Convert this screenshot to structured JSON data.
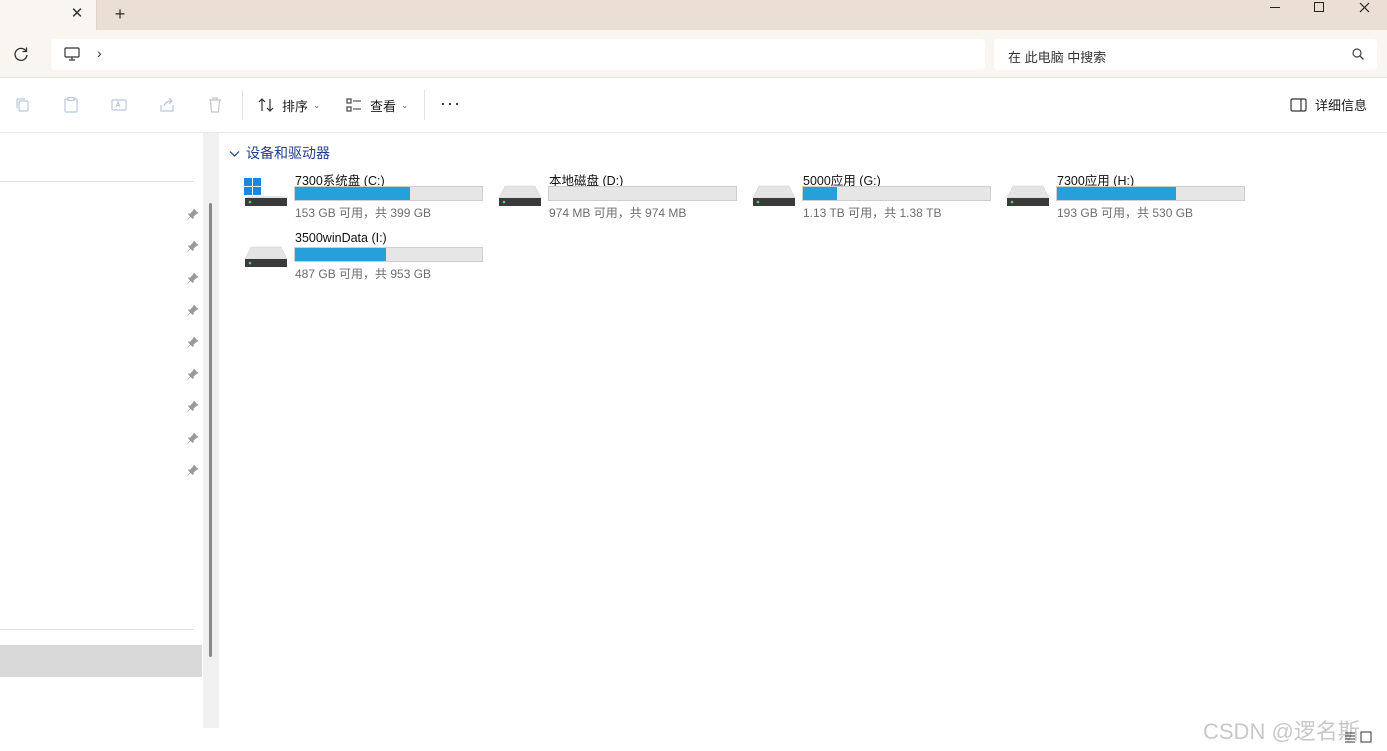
{
  "window": {
    "tab_close_glyph": "✕",
    "new_tab_glyph": "+",
    "controls": [
      "minimize-icon",
      "maximize-icon",
      "close-icon"
    ]
  },
  "address": {
    "breadcrumb_icon": "this-pc-icon",
    "breadcrumb_chevron": "›",
    "search_placeholder": "在 此电脑 中搜索"
  },
  "toolbar": {
    "sort_label": "排序",
    "view_label": "查看",
    "more_label": "···",
    "details_label": "详细信息"
  },
  "main": {
    "group_label": "设备和驱动器",
    "drives": [
      {
        "name": "7300系统盘 (C:)",
        "size_text": "153 GB 可用，共 399 GB",
        "used_fraction": 0.617,
        "icon": "windows-drive-icon"
      },
      {
        "name": "本地磁盘 (D:)",
        "size_text": "974 MB 可用，共 974 MB",
        "used_fraction": 0.0,
        "icon": "drive-icon"
      },
      {
        "name": "5000应用 (G:)",
        "size_text": "1.13 TB 可用，共 1.38 TB",
        "used_fraction": 0.181,
        "icon": "drive-icon"
      },
      {
        "name": "7300应用 (H:)",
        "size_text": "193 GB 可用，共 530 GB",
        "used_fraction": 0.636,
        "icon": "drive-icon"
      },
      {
        "name": "3500winData (I:)",
        "size_text": "487 GB 可用，共 953 GB",
        "used_fraction": 0.489,
        "icon": "drive-icon"
      }
    ]
  },
  "watermark": "CSDN @逻名斯",
  "colors": {
    "accent_bar": "#26a0da",
    "group_header": "#1f3f8f",
    "titlebar": "#eadfd2"
  }
}
